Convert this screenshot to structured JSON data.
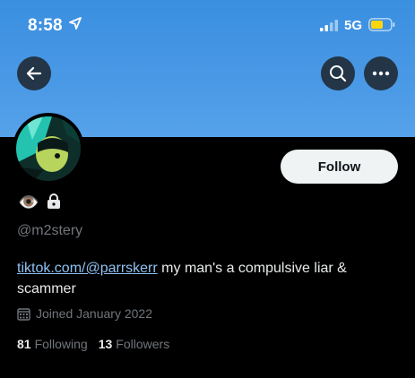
{
  "status_bar": {
    "time": "8:58",
    "network": "5G"
  },
  "profile": {
    "handle": "@m2stery",
    "name_emoji": "👁️",
    "bio_link": "tiktok.com/@parrskerr",
    "bio_text": " my man's a compulsive liar & scammer",
    "joined": "Joined January 2022",
    "following_count": "81",
    "following_label": "Following",
    "followers_count": "13",
    "followers_label": "Followers"
  },
  "actions": {
    "follow_label": "Follow"
  },
  "icons": {
    "back": "arrow-left-icon",
    "search": "search-icon",
    "more": "more-horizontal-icon",
    "lock": "lock-icon",
    "calendar": "calendar-icon",
    "location": "location-arrow-icon",
    "battery": "battery-icon",
    "signal": "cellular-signal-icon"
  },
  "colors": {
    "banner": "#4a99e6",
    "link": "#8fc1f2",
    "muted": "#71767b",
    "button_bg": "#eff3f4",
    "battery": "#ffd60a"
  }
}
